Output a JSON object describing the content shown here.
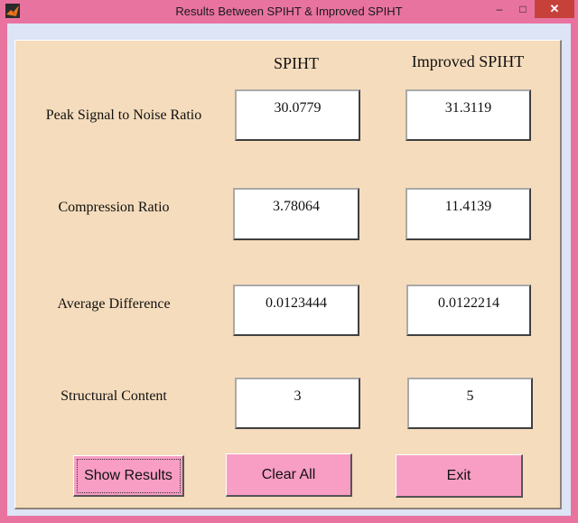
{
  "window": {
    "title": "Results Between SPIHT & Improved SPIHT",
    "minimize": "–",
    "maximize": "□",
    "close": "✕"
  },
  "columns": {
    "spiht": "SPIHT",
    "improved": "Improved SPIHT"
  },
  "rows": [
    {
      "label": "Peak Signal to Noise Ratio",
      "spiht": "30.0779",
      "improved": "31.3119"
    },
    {
      "label": "Compression Ratio",
      "spiht": "3.78064",
      "improved": "11.4139"
    },
    {
      "label": "Average Difference",
      "spiht": "0.0123444",
      "improved": "0.0122214"
    },
    {
      "label": "Structural Content",
      "spiht": "3",
      "improved": "5"
    }
  ],
  "buttons": {
    "show_results": "Show Results",
    "clear_all": "Clear All",
    "exit": "Exit"
  }
}
